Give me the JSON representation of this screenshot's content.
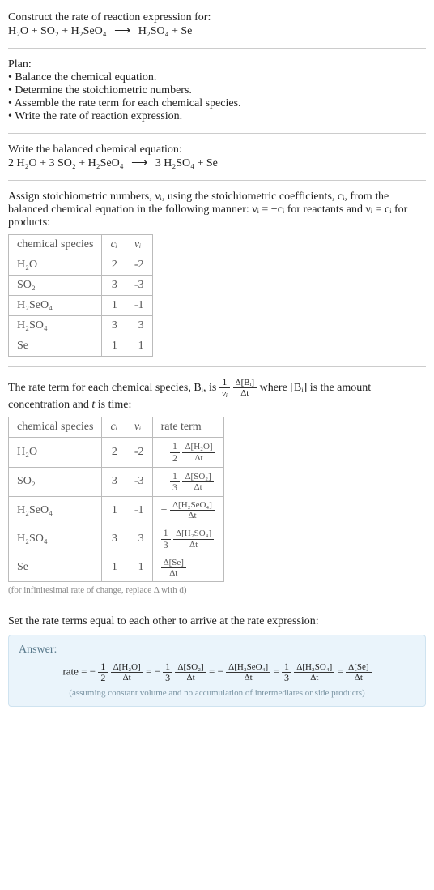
{
  "header": {
    "prompt": "Construct the rate of reaction expression for:",
    "equation_lhs": "H₂O + SO₂ + H₂SeO₄",
    "equation_rhs": "H₂SO₄ + Se"
  },
  "plan": {
    "title": "Plan:",
    "bullets": [
      "Balance the chemical equation.",
      "Determine the stoichiometric numbers.",
      "Assemble the rate term for each chemical species.",
      "Write the rate of reaction expression."
    ]
  },
  "balanced": {
    "title": "Write the balanced chemical equation:",
    "lhs": "2 H₂O + 3 SO₂ + H₂SeO₄",
    "rhs": "3 H₂SO₄ + Se"
  },
  "assign": {
    "text": "Assign stoichiometric numbers, νᵢ, using the stoichiometric coefficients, cᵢ, from the balanced chemical equation in the following manner: νᵢ = −cᵢ for reactants and νᵢ = cᵢ for products:",
    "headers": [
      "chemical species",
      "cᵢ",
      "νᵢ"
    ],
    "rows": [
      {
        "sp": "H₂O",
        "c": "2",
        "v": "-2"
      },
      {
        "sp": "SO₂",
        "c": "3",
        "v": "-3"
      },
      {
        "sp": "H₂SeO₄",
        "c": "1",
        "v": "-1"
      },
      {
        "sp": "H₂SO₄",
        "c": "3",
        "v": "3"
      },
      {
        "sp": "Se",
        "c": "1",
        "v": "1"
      }
    ]
  },
  "rateterm": {
    "intro_a": "The rate term for each chemical species, Bᵢ, is ",
    "intro_b": " where [Bᵢ] is the amount concentration and ",
    "intro_c": " is time:",
    "t_label": "t",
    "frac1_num": "1",
    "frac1_den": "νᵢ",
    "frac2_num": "Δ[Bᵢ]",
    "frac2_den": "Δt",
    "headers": [
      "chemical species",
      "cᵢ",
      "νᵢ",
      "rate term"
    ],
    "rows": [
      {
        "sp": "H₂O",
        "c": "2",
        "v": "-2",
        "coef_sign": "−",
        "coef_num": "1",
        "coef_den": "2",
        "dnum": "Δ[H₂O]",
        "dden": "Δt"
      },
      {
        "sp": "SO₂",
        "c": "3",
        "v": "-3",
        "coef_sign": "−",
        "coef_num": "1",
        "coef_den": "3",
        "dnum": "Δ[SO₂]",
        "dden": "Δt"
      },
      {
        "sp": "H₂SeO₄",
        "c": "1",
        "v": "-1",
        "coef_sign": "−",
        "coef_num": "",
        "coef_den": "",
        "dnum": "Δ[H₂SeO₄]",
        "dden": "Δt"
      },
      {
        "sp": "H₂SO₄",
        "c": "3",
        "v": "3",
        "coef_sign": "",
        "coef_num": "1",
        "coef_den": "3",
        "dnum": "Δ[H₂SO₄]",
        "dden": "Δt"
      },
      {
        "sp": "Se",
        "c": "1",
        "v": "1",
        "coef_sign": "",
        "coef_num": "",
        "coef_den": "",
        "dnum": "Δ[Se]",
        "dden": "Δt"
      }
    ],
    "note": "(for infinitesimal rate of change, replace Δ with d)"
  },
  "final": {
    "title": "Set the rate terms equal to each other to arrive at the rate expression:",
    "answer_label": "Answer:",
    "rate_word": "rate = ",
    "terms": [
      {
        "sign": "−",
        "cnum": "1",
        "cden": "2",
        "dnum": "Δ[H₂O]",
        "dden": "Δt"
      },
      {
        "sign": "−",
        "cnum": "1",
        "cden": "3",
        "dnum": "Δ[SO₂]",
        "dden": "Δt"
      },
      {
        "sign": "−",
        "cnum": "",
        "cden": "",
        "dnum": "Δ[H₂SeO₄]",
        "dden": "Δt"
      },
      {
        "sign": "",
        "cnum": "1",
        "cden": "3",
        "dnum": "Δ[H₂SO₄]",
        "dden": "Δt"
      },
      {
        "sign": "",
        "cnum": "",
        "cden": "",
        "dnum": "Δ[Se]",
        "dden": "Δt"
      }
    ],
    "note": "(assuming constant volume and no accumulation of intermediates or side products)"
  }
}
